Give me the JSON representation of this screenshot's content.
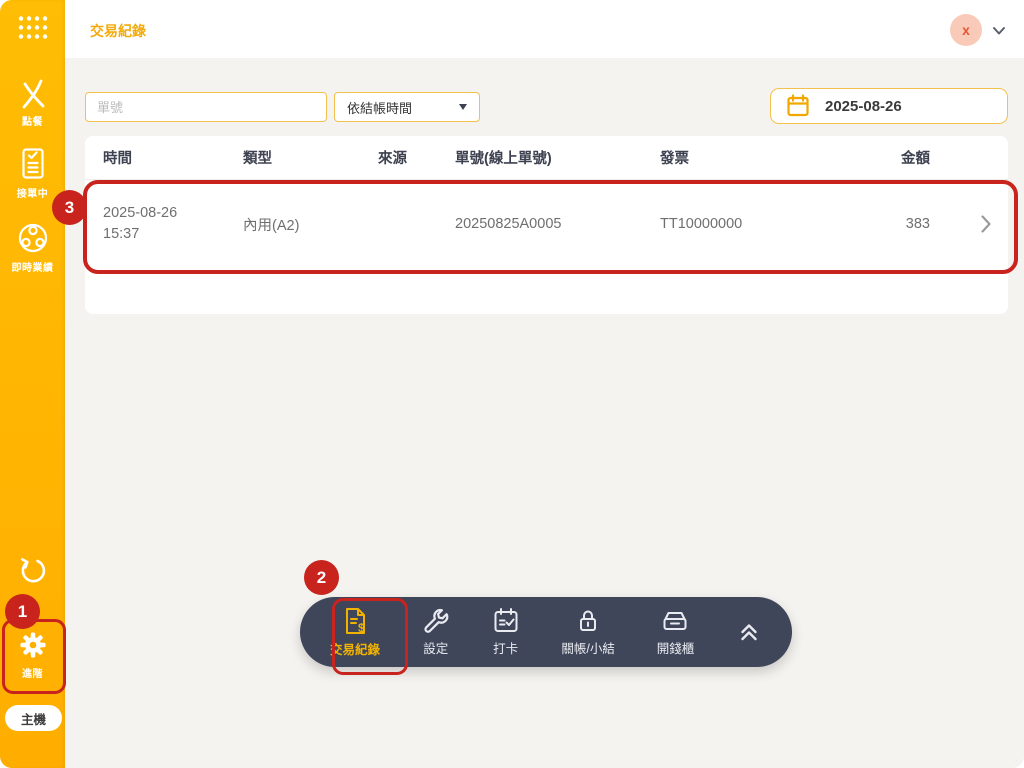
{
  "header": {
    "title": "交易紀錄",
    "avatar_initial": "x"
  },
  "sidebar": {
    "items": [
      {
        "label": "點餐",
        "icon": "dine-order-icon"
      },
      {
        "label": "接單中",
        "icon": "orders-clipboard-icon"
      },
      {
        "label": "即時業績",
        "icon": "live-performance-icon"
      }
    ],
    "refresh_icon": "refresh-icon",
    "advanced_label": "進階",
    "host_label": "主機"
  },
  "filters": {
    "order_placeholder": "單號",
    "sort_value": "依結帳時間",
    "date_value": "2025-08-26"
  },
  "table": {
    "headers": [
      "時間",
      "類型",
      "來源",
      "單號(線上單號)",
      "發票",
      "金額"
    ],
    "rows": [
      {
        "date": "2025-08-26",
        "time": "15:37",
        "type": "內用(A2)",
        "source": "",
        "order_no": "20250825A0005",
        "invoice": "TT10000000",
        "amount": "383"
      }
    ]
  },
  "toolbar": {
    "items": [
      {
        "label": "交易紀錄",
        "icon": "document-dollar-icon",
        "active": true
      },
      {
        "label": "設定",
        "icon": "wrench-icon",
        "active": false
      },
      {
        "label": "打卡",
        "icon": "calendar-check-icon",
        "active": false
      },
      {
        "label": "關帳/小結",
        "icon": "padlock-icon",
        "active": false
      },
      {
        "label": "開錢櫃",
        "icon": "cash-drawer-icon",
        "active": false
      }
    ],
    "collapse_icon": "double-chevron-up-icon"
  },
  "annotations": {
    "steps": [
      "1",
      "2",
      "3"
    ]
  },
  "colors": {
    "sidebar_yellow": "#FFB400",
    "accent_gold": "#F3AB0C",
    "input_border": "#F3C14E",
    "toolbar_bg": "#3F465A",
    "annotation_red": "#C8231C",
    "avatar_bg": "#F9CAB7",
    "avatar_text": "#E45737",
    "content_bg": "#F5F3EF"
  }
}
